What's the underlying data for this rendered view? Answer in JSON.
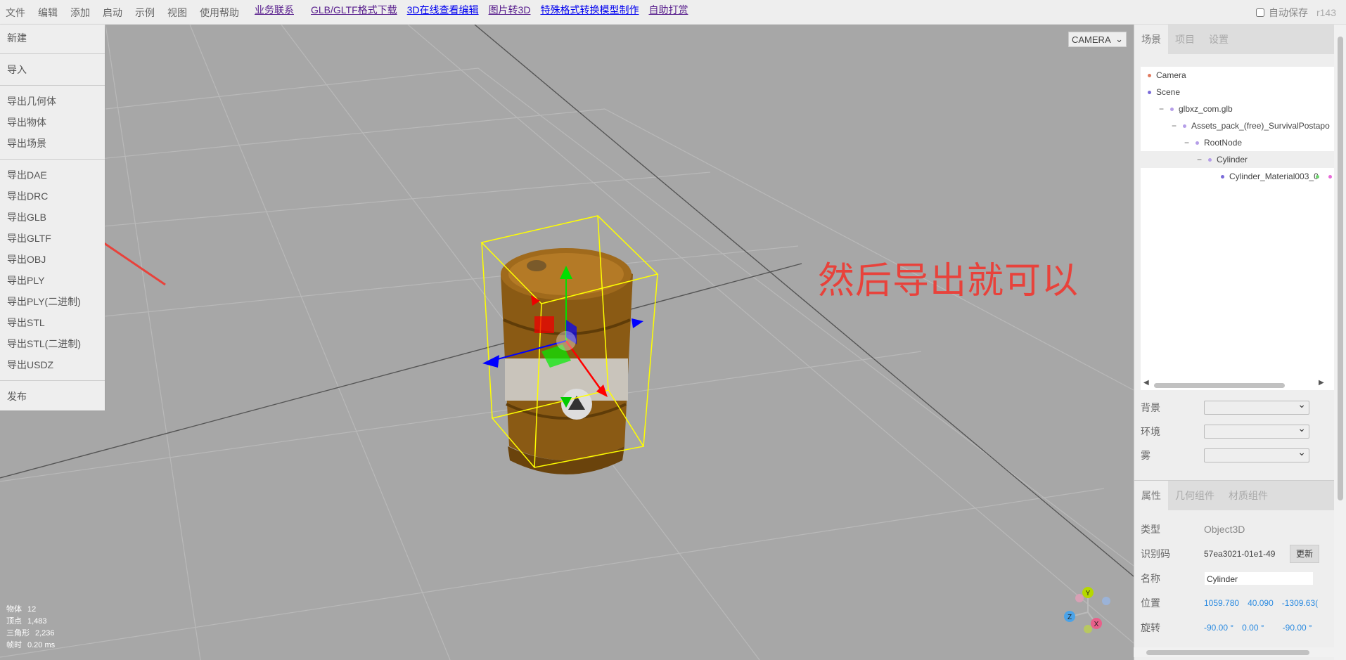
{
  "menubar": {
    "items": [
      "文件",
      "编辑",
      "添加",
      "启动",
      "示例",
      "视图",
      "使用帮助"
    ],
    "links": [
      {
        "label": "业务联系",
        "color": "purple"
      },
      {
        "label": "GLB/GLTF格式下载",
        "color": "purple"
      },
      {
        "label": "3D在线查看编辑",
        "color": "blue"
      },
      {
        "label": "图片转3D",
        "color": "purple"
      },
      {
        "label": "特殊格式转换模型制作",
        "color": "blue"
      },
      {
        "label": "自助打赏",
        "color": "purple"
      }
    ],
    "autosave_label": "自动保存",
    "autosave_checked": false,
    "version": "r143"
  },
  "file_menu": {
    "groups": [
      [
        "新建"
      ],
      [
        "导入"
      ],
      [
        "导出几何体",
        "导出物体",
        "导出场景"
      ],
      [
        "导出DAE",
        "导出DRC",
        "导出GLB",
        "导出GLTF",
        "导出OBJ",
        "导出PLY",
        "导出PLY(二进制)",
        "导出STL",
        "导出STL(二进制)",
        "导出USDZ"
      ],
      [
        "发布"
      ]
    ]
  },
  "viewport": {
    "camera_select": "CAMERA",
    "annotation": "然后导出就可以",
    "stats": [
      {
        "label": "物体",
        "value": "12"
      },
      {
        "label": "顶点",
        "value": "1,483"
      },
      {
        "label": "三角形",
        "value": "2,236"
      },
      {
        "label": "帧时",
        "value": "0.20 ms"
      }
    ],
    "axis_labels": {
      "y": "Y",
      "z": "Z",
      "x": "X"
    }
  },
  "sidebar": {
    "tabs": [
      "场景",
      "项目",
      "设置"
    ],
    "active_tab": "场景",
    "outliner": [
      {
        "label": "Camera",
        "indent": 0,
        "toggle": "",
        "dot": "#e07a5f",
        "selected": false
      },
      {
        "label": "Scene",
        "indent": 0,
        "toggle": "",
        "dot": "#7b6cd9",
        "selected": false
      },
      {
        "label": "glbxz_com.glb",
        "indent": 1,
        "toggle": "−",
        "dot": "#b59ee8",
        "selected": false
      },
      {
        "label": "Assets_pack_(free)_SurvivalPostapo",
        "indent": 2,
        "toggle": "−",
        "dot": "#b59ee8",
        "selected": false
      },
      {
        "label": "RootNode",
        "indent": 3,
        "toggle": "−",
        "dot": "#b59ee8",
        "selected": false
      },
      {
        "label": "Cylinder",
        "indent": 4,
        "toggle": "−",
        "dot": "#b59ee8",
        "selected": true
      },
      {
        "label": "Cylinder_Material003_0",
        "indent": 5,
        "toggle": "",
        "dot": "#7b6cd9",
        "selected": false
      }
    ],
    "scene_props": [
      {
        "label": "背景"
      },
      {
        "label": "环境"
      },
      {
        "label": "雾"
      }
    ],
    "prop_tabs": [
      "属性",
      "几何组件",
      "材质组件"
    ],
    "active_prop_tab": "属性",
    "object": {
      "type_label": "类型",
      "type_value": "Object3D",
      "uuid_label": "识别码",
      "uuid_value": "57ea3021-01e1-49",
      "update_button": "更新",
      "name_label": "名称",
      "name_value": "Cylinder",
      "position_label": "位置",
      "position": [
        "1059.780",
        "40.090",
        "-1309.63("
      ],
      "rotation_label": "旋转",
      "rotation": [
        "-90.00 °",
        "0.00 °",
        "-90.00 °"
      ]
    }
  }
}
